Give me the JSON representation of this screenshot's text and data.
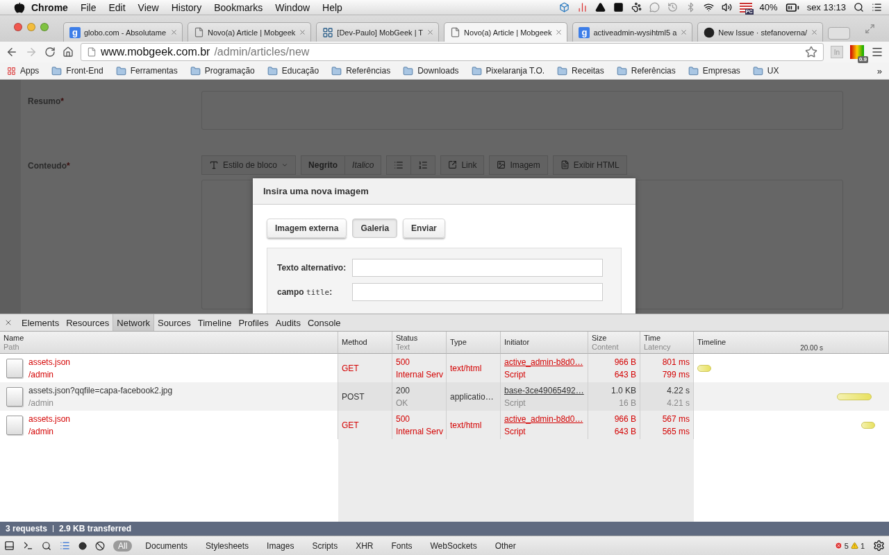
{
  "menubar": {
    "app": "Chrome",
    "items": [
      "File",
      "Edit",
      "View",
      "History",
      "Bookmarks",
      "Window",
      "Help"
    ],
    "flag_badge": "PC",
    "battery": "40%",
    "clock": "sex 13:13"
  },
  "tabs": [
    {
      "kind": "letter",
      "badge": "g",
      "title": "globo.com - Absolutame",
      "selected": false
    },
    {
      "kind": "page",
      "title": "Novo(a) Article | Mobgeek",
      "selected": false
    },
    {
      "kind": "board",
      "title": "[Dev-Paulo] MobGeek | T",
      "selected": false
    },
    {
      "kind": "page",
      "title": "Novo(a) Article | Mobgeek",
      "selected": true
    },
    {
      "kind": "letter",
      "badge": "g",
      "title": "activeadmin-wysihtml5 a",
      "selected": false
    },
    {
      "kind": "octo",
      "title": "New Issue · stefanoverna/",
      "selected": false
    }
  ],
  "toolbar": {
    "host": "www.mobgeek.com.br",
    "path": "/admin/articles/new",
    "extension": "In",
    "picker_badge": "0.9"
  },
  "bookmarks": {
    "apps": "Apps",
    "folders": [
      "Front-End",
      "Ferramentas",
      "Programação",
      "Educação",
      "Referências",
      "Downloads",
      "Pixelaranja T.O.",
      "Receitas",
      "Referências",
      "Empresas",
      "UX"
    ],
    "more": "»"
  },
  "form": {
    "fields": [
      {
        "label": "Resumo",
        "required": "*",
        "kind": "textarea"
      },
      {
        "label": "Conteudo",
        "required": "*",
        "kind": "editor"
      }
    ],
    "editor_toolbar": [
      {
        "buttons": [
          {
            "kind": "dropdown",
            "label": "Estilo de bloco"
          }
        ]
      },
      {
        "buttons": [
          {
            "kind": "bold",
            "label": "Negrito"
          },
          {
            "kind": "italic",
            "label": "Italico"
          }
        ]
      },
      {
        "buttons": [
          {
            "kind": "bullets"
          },
          {
            "kind": "numbers"
          }
        ]
      },
      {
        "buttons": [
          {
            "kind": "link",
            "label": "Link"
          }
        ]
      },
      {
        "buttons": [
          {
            "kind": "image",
            "label": "Imagem"
          }
        ]
      },
      {
        "buttons": [
          {
            "kind": "html",
            "label": "Exibir HTML"
          }
        ]
      }
    ]
  },
  "dialog": {
    "title": "Insira uma nova imagem",
    "tabs": [
      {
        "label": "Imagem externa",
        "selected": false
      },
      {
        "label": "Galeria",
        "selected": true
      },
      {
        "label": "Enviar",
        "selected": false
      }
    ],
    "fields": [
      {
        "label": "Texto alternativo:"
      },
      {
        "label": "campo ",
        "code": "title",
        "suffix": ":"
      }
    ]
  },
  "devtools": {
    "tabs": [
      {
        "label": "Elements",
        "selected": false
      },
      {
        "label": "Resources",
        "selected": false
      },
      {
        "label": "Network",
        "selected": true
      },
      {
        "label": "Sources",
        "selected": false
      },
      {
        "label": "Timeline",
        "selected": false
      },
      {
        "label": "Profiles",
        "selected": false
      },
      {
        "label": "Audits",
        "selected": false
      },
      {
        "label": "Console",
        "selected": false
      }
    ],
    "columns": [
      {
        "name": "Name",
        "sub": "Path"
      },
      {
        "name": "Method"
      },
      {
        "name": "Status",
        "sub": "Text"
      },
      {
        "name": "Type"
      },
      {
        "name": "Initiator"
      },
      {
        "name": "Size",
        "sub": "Content"
      },
      {
        "name": "Time",
        "sub": "Latency"
      },
      {
        "name": "Timeline"
      }
    ],
    "timeline_tick": "20.00 s",
    "rows": [
      {
        "name": "assets.json",
        "path": "/admin",
        "method": "GET",
        "status": "500",
        "status_text": "Internal Serv",
        "type": "text/html",
        "initiator": "active_admin-b8d0…",
        "initiator_type": "Script",
        "size": "966 B",
        "content": "643 B",
        "time": "801 ms",
        "latency": "799 ms",
        "error": true,
        "bar": {
          "kind": "short",
          "level": 0.09
        }
      },
      {
        "name": "assets.json?qqfile=capa-facebook2.jpg",
        "path": "/admin",
        "method": "POST",
        "status": "200",
        "status_text": "OK",
        "type": "applicatio…",
        "initiator": "base-3ce49065492…",
        "initiator_type": "Script",
        "size": "1.0 KB",
        "content": "16 B",
        "time": "4.22 s",
        "latency": "4.21 s",
        "error": false,
        "bar": {
          "kind": "long",
          "level": 0.91
        }
      },
      {
        "name": "assets.json",
        "path": "/admin",
        "method": "GET",
        "status": "500",
        "status_text": "Internal Serv",
        "type": "text/html",
        "initiator": "active_admin-b8d0…",
        "initiator_type": "Script",
        "size": "966 B",
        "content": "643 B",
        "time": "567 ms",
        "latency": "565 ms",
        "error": true,
        "bar": {
          "kind": "short",
          "level": 0.93
        }
      }
    ],
    "summary": {
      "requests": "3 requests",
      "transferred": "2.9 KB transferred"
    },
    "filters": [
      {
        "label": "All",
        "selected": true
      },
      {
        "label": "Documents",
        "selected": false
      },
      {
        "label": "Stylesheets",
        "selected": false
      },
      {
        "label": "Images",
        "selected": false
      },
      {
        "label": "Scripts",
        "selected": false
      },
      {
        "label": "XHR",
        "selected": false
      },
      {
        "label": "Fonts",
        "selected": false
      },
      {
        "label": "WebSockets",
        "selected": false
      },
      {
        "label": "Other",
        "selected": false
      }
    ],
    "errors": "5",
    "warnings": "1"
  }
}
